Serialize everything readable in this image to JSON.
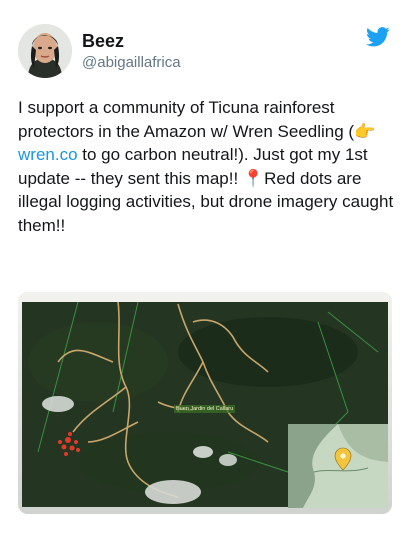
{
  "tweet": {
    "author_name": "Beez",
    "handle": "@abigaillafrica",
    "text_part1": "I support a community of Ticuna rainforest protectors in the Amazon w/ Wren Seedling (",
    "emoji_pointing": "👉",
    "link_text": "wren.co",
    "text_part2": " to go carbon neutral!). Just got my 1st update -- they sent this map!! ",
    "emoji_pin": "📍",
    "text_part3": "Red dots are illegal logging activities, but drone imagery caught them!!"
  },
  "brand": {
    "icon": "twitter-bird-icon",
    "color": "#1da1f2"
  },
  "map": {
    "place_label": "Buen Jardin del Callaru",
    "marker_icon": "map-pin-icon"
  }
}
